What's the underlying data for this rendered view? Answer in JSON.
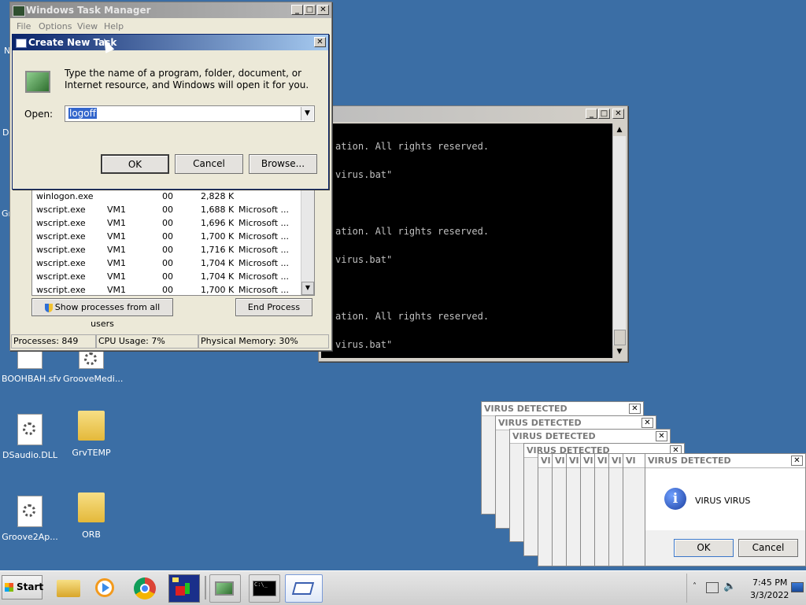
{
  "desktop": {
    "icons": [
      {
        "label": "BOOHBAH.sfv"
      },
      {
        "label": "GrooveMedi..."
      },
      {
        "label": "DSaudio.DLL"
      },
      {
        "label": "GrvTEMP"
      },
      {
        "label": "Groove2Ap..."
      },
      {
        "label": "ORB"
      }
    ],
    "edge_labels": [
      "N",
      "D",
      "Gr"
    ]
  },
  "task_manager": {
    "title": "Windows Task Manager",
    "menu": [
      "File",
      "Options",
      "View",
      "Help"
    ],
    "processes": [
      {
        "name": "winlogon.exe",
        "user": "",
        "cpu": "00",
        "mem": "2,828 K",
        "desc": ""
      },
      {
        "name": "wscript.exe",
        "user": "VM1",
        "cpu": "00",
        "mem": "1,688 K",
        "desc": "Microsoft ..."
      },
      {
        "name": "wscript.exe",
        "user": "VM1",
        "cpu": "00",
        "mem": "1,696 K",
        "desc": "Microsoft ..."
      },
      {
        "name": "wscript.exe",
        "user": "VM1",
        "cpu": "00",
        "mem": "1,700 K",
        "desc": "Microsoft ..."
      },
      {
        "name": "wscript.exe",
        "user": "VM1",
        "cpu": "00",
        "mem": "1,716 K",
        "desc": "Microsoft ..."
      },
      {
        "name": "wscript.exe",
        "user": "VM1",
        "cpu": "00",
        "mem": "1,704 K",
        "desc": "Microsoft ..."
      },
      {
        "name": "wscript.exe",
        "user": "VM1",
        "cpu": "00",
        "mem": "1,704 K",
        "desc": "Microsoft ..."
      },
      {
        "name": "wscript.exe",
        "user": "VM1",
        "cpu": "00",
        "mem": "1,700 K",
        "desc": "Microsoft ..."
      }
    ],
    "show_all_label": "Show processes from all users",
    "end_process_label": "End Process",
    "status": {
      "processes": "Processes: 849",
      "cpu": "CPU Usage: 7%",
      "memory": "Physical Memory: 30%"
    }
  },
  "create_task": {
    "title": "Create New Task",
    "description": "Type the name of a program, folder, document, or Internet resource, and Windows will open it for you.",
    "open_label": "Open:",
    "open_value": "logoff",
    "ok_label": "OK",
    "cancel_label": "Cancel",
    "browse_label": "Browse..."
  },
  "console": {
    "lines": [
      {
        "text": "ation.  All rights reserved."
      },
      {
        "text": "virus.bat\""
      },
      {
        "text": "ation.  All rights reserved."
      },
      {
        "text": "virus.bat\""
      },
      {
        "text": "ation.  All rights reserved."
      },
      {
        "text": "virus.bat\""
      }
    ]
  },
  "virus_dialogs": {
    "title": "VIRUS DETECTED",
    "stack_titles": [
      "VIRUS DETECTED",
      "VIRUS DETECTED",
      "VIRUS DETECTED",
      "VIRUS DETECTED"
    ],
    "small_titles": [
      "VI",
      "VI",
      "VI",
      "VI",
      "VI",
      "VI",
      "VI"
    ],
    "message": "VIRUS VIRUS",
    "ok_label": "OK",
    "cancel_label": "Cancel"
  },
  "taskbar": {
    "start_label": "Start",
    "clock_time": "7:45 PM",
    "clock_date": "3/3/2022"
  }
}
